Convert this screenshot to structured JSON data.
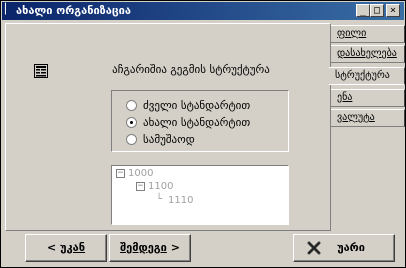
{
  "window": {
    "title": "ახალი ორგანიზაცია",
    "minimize_glyph": "_",
    "maximize_glyph": "□",
    "close_glyph": "×"
  },
  "panel": {
    "title": "აჩგარიშია გეგმის სტრუქტურა"
  },
  "radio_group": {
    "options": [
      {
        "label": "ძველი სტანდარტით",
        "selected": false
      },
      {
        "label": "ახალი სტანდარტით",
        "selected": true
      },
      {
        "label": "სამუშაოდ",
        "selected": false
      }
    ]
  },
  "tree": {
    "nodes": [
      {
        "label": "1000",
        "toggle": "−"
      },
      {
        "label": "1100",
        "toggle": "−"
      },
      {
        "label": "1110",
        "connector": "└"
      }
    ]
  },
  "side_tabs": [
    {
      "label": "ფილი",
      "active": false
    },
    {
      "label": "დასახელება",
      "active": false
    },
    {
      "label": "სტრუქტურა",
      "active": true
    },
    {
      "label": "ენა",
      "active": false
    },
    {
      "label": "ვალუტა",
      "active": false
    }
  ],
  "buttons": {
    "back": {
      "arrow": "<",
      "label": "უკან"
    },
    "next": {
      "label": "შემდეგი",
      "arrow": ">"
    },
    "cancel": {
      "label": "უარი"
    }
  },
  "colors": {
    "title_gradient_start": "#0a246a",
    "title_gradient_end": "#3a6ea5",
    "face": "#d4d0c8",
    "disabled_text": "#a0a0a0"
  }
}
